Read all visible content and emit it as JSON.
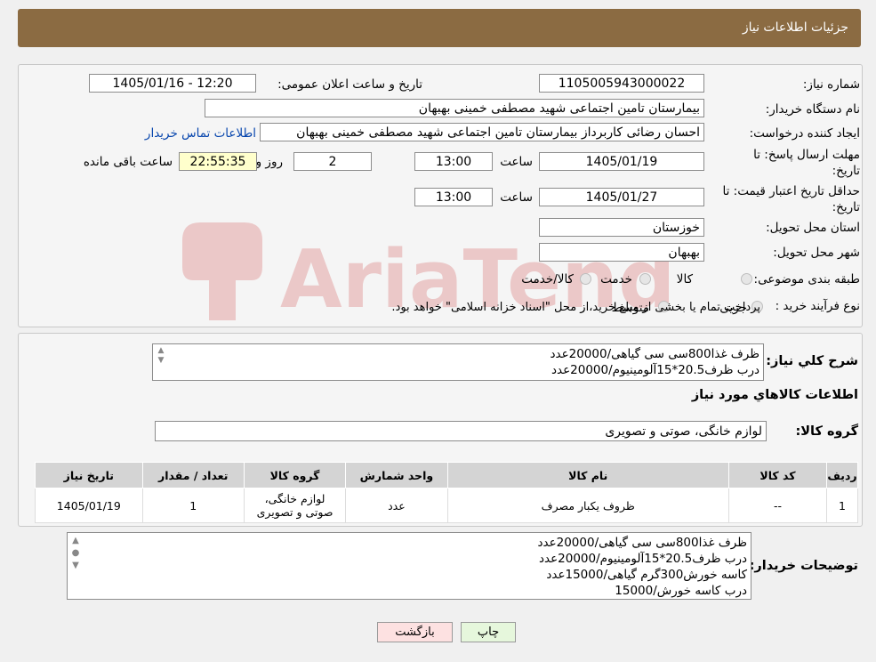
{
  "header": {
    "title": "جزئیات اطلاعات نیاز"
  },
  "form": {
    "need_number_label": "شماره نیاز:",
    "need_number": "1105005943000022",
    "announce_label": "تاریخ و ساعت اعلان عمومی:",
    "announce_value": "1405/01/16 - 12:20",
    "buyer_org_label": "نام دستگاه خریدار:",
    "buyer_org": "بیمارستان تامین اجتماعی شهید مصطفی خمینی بهبهان",
    "creator_label": "ایجاد کننده درخواست:",
    "creator": "احسان رضائی کاربرداز بیمارستان تامین اجتماعی شهید مصطفی خمینی بهبهان",
    "contact_link": "اطلاعات تماس خریدار",
    "deadline_label_1": "مهلت ارسال پاسخ: تا",
    "deadline_label_2": "تاریخ:",
    "deadline_date": "1405/01/19",
    "time_label": "ساعت",
    "deadline_time": "13:00",
    "days_value": "2",
    "days_label": "روز و",
    "remaining_time": "22:55:35",
    "remaining_label": "ساعت باقی مانده",
    "validity_label_1": "حداقل تاریخ اعتبار قیمت: تا",
    "validity_label_2": "تاریخ:",
    "validity_date": "1405/01/27",
    "validity_time_label": "ساعت",
    "validity_time": "13:00",
    "province_label": "استان محل تحویل:",
    "province": "خوزستان",
    "city_label": "شهر محل تحویل:",
    "city": "بهبهان",
    "category_label": "طبقه بندی موضوعی:",
    "category_options": [
      "کالا",
      "خدمت",
      "کالا/خدمت"
    ],
    "process_label": "نوع فرآیند خرید :",
    "process_options": [
      "جزیی",
      "متوسط"
    ],
    "process_note": "پرداخت تمام یا بخشی از مبلغ خرید،از محل \"اسناد خزانه اسلامی\" خواهد بود."
  },
  "summary": {
    "label": "شرح کلي نياز:",
    "lines": [
      "ظرف غذا800سی سی گیاهی/20000عدد",
      "درب ظرف20.5*15آلومینیوم/20000عدد"
    ]
  },
  "goods": {
    "section_title": "اطلاعات کالاهاي مورد نياز",
    "group_label": "گروه کالا:",
    "group_value": "لوازم خانگی، صوتی و تصویری"
  },
  "table": {
    "headers": [
      "رديف",
      "کد کالا",
      "نام کالا",
      "واحد شمارش",
      "گروه کالا",
      "تعداد / مقدار",
      "تاریخ نیاز"
    ],
    "row": {
      "index": "1",
      "code": "--",
      "name": "ظروف یکبار مصرف",
      "unit": "عدد",
      "group_line1": "لوازم خانگی،",
      "group_line2": "صوتی و تصویری",
      "qty": "1",
      "date": "1405/01/19"
    }
  },
  "buyer_notes": {
    "label": "توضیحات خریدار:",
    "lines": [
      "ظرف غذا800سی سی گیاهی/20000عدد",
      "درب ظرف20.5*15آلومینیوم/20000عدد",
      "کاسه خورش300گرم گیاهی/15000عدد",
      "درب کاسه خورش/15000"
    ]
  },
  "buttons": {
    "print": "چاپ",
    "back": "بازگشت"
  },
  "watermark": {
    "text": "AriaTender.neT"
  },
  "colors": {
    "header": "#8b6b42",
    "link": "#0645ad",
    "remaining": "#ffffcc",
    "back_button": "#fde1e1",
    "print_button": "#e6f7dc"
  }
}
